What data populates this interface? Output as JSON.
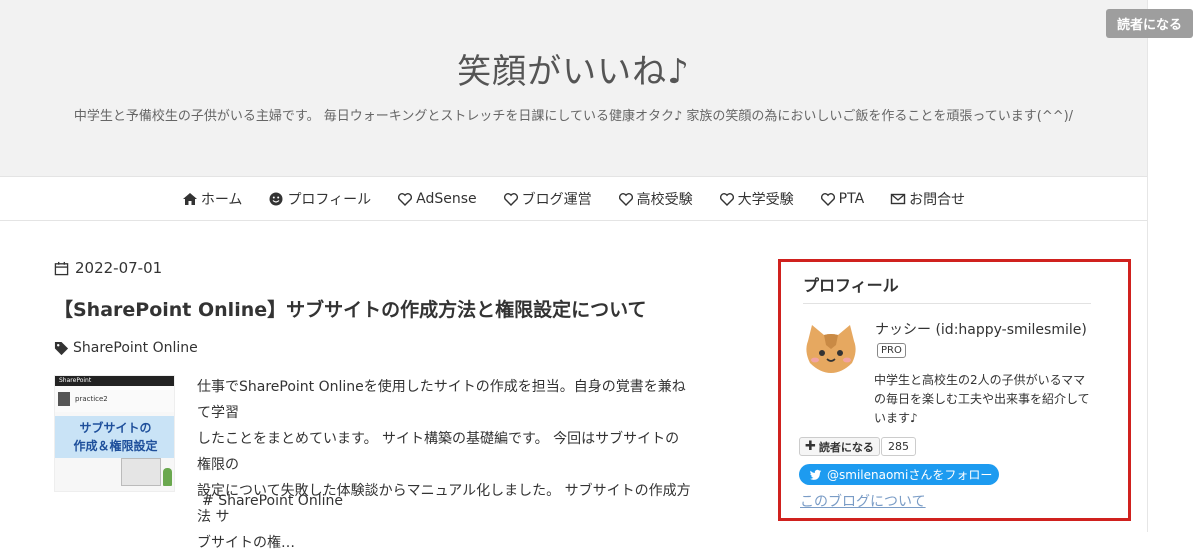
{
  "header": {
    "site_title": "笑顔がいいね♪",
    "description": "中学生と予備校生の子供がいる主婦です。 毎日ウォーキングとストレッチを日課にしている健康オタク♪ 家族の笑顔の為においしいご飯を作ることを頑張っています(^^)/",
    "reader_button": "読者になる"
  },
  "nav": {
    "items": [
      {
        "label": "ホーム",
        "icon": "home-icon"
      },
      {
        "label": "プロフィール",
        "icon": "smile-icon"
      },
      {
        "label": "AdSense",
        "icon": "heart-icon"
      },
      {
        "label": "ブログ運営",
        "icon": "heart-icon"
      },
      {
        "label": "高校受験",
        "icon": "heart-icon"
      },
      {
        "label": "大学受験",
        "icon": "heart-icon"
      },
      {
        "label": "PTA",
        "icon": "heart-icon"
      },
      {
        "label": "お問合せ",
        "icon": "mail-icon"
      }
    ]
  },
  "post": {
    "date": "2022-07-01",
    "title": "【SharePoint Online】サブサイトの作成方法と権限設定について",
    "category": "SharePoint Online",
    "thumbnail": {
      "bar_text": "SharePoint",
      "sub_text": "practice2",
      "banner_line1": "サブサイトの",
      "banner_line2": "作成＆権限設定"
    },
    "excerpt_lines": [
      "仕事でSharePoint Onlineを使用したサイトの作成を担当。自身の覚書を兼ねて学習",
      "したことをまとめています。 サイト構築の基礎編です。 今回はサブサイトの権限の",
      "設定について失敗した体験談からマニュアル化しました。 サブサイトの作成方法 サ",
      "ブサイトの権…"
    ],
    "hashtag": "SharePoint Online"
  },
  "profile": {
    "heading": "プロフィール",
    "name": "ナッシー (id:happy-smilesmile)",
    "badge": "PRO",
    "description": "中学生と高校生の2人の子供がいるママの毎日を楽しむ工夫や出来事を紹介しています♪",
    "follow_label": "読者になる",
    "follow_count": "285",
    "twitter_label": "@smilenaomiさんをフォロー",
    "about_link": "このブログについて"
  },
  "colors": {
    "highlight_border": "#d0211e",
    "twitter": "#1d9bf0",
    "header_bg": "#f2f2f2",
    "link": "#7a9cc6"
  }
}
